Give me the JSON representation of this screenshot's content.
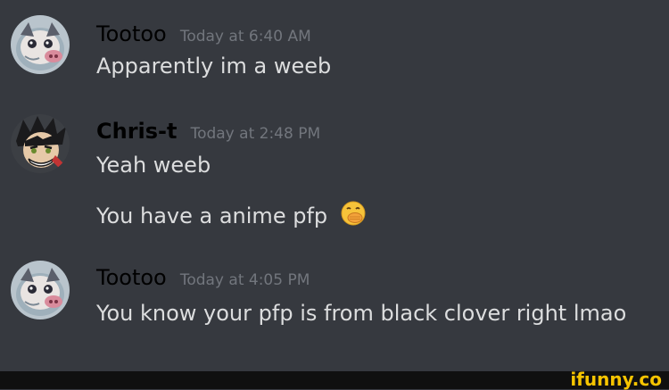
{
  "messages": [
    {
      "username": "Tootoo",
      "timestamp": "Today at 6:40 AM",
      "lines": [
        "Apparently im a weeb"
      ],
      "avatar": "boar-mask-avatar"
    },
    {
      "username": "Chris-t",
      "timestamp": "Today at 2:48 PM",
      "lines": [
        "Yeah weeb",
        "You have a anime pfp"
      ],
      "avatar": "anime-character-avatar",
      "emoji": "face-with-hand-over-mouth-emoji"
    },
    {
      "username": "Tootoo",
      "timestamp": "Today at 4:05 PM",
      "lines": [
        "You know your pfp is from black clover right lmao"
      ],
      "avatar": "boar-mask-avatar"
    }
  ],
  "watermark": "ifunny.co",
  "colors": {
    "background": "#36393f",
    "message_text": "#dcddde",
    "timestamp": "#72767d",
    "username": "#000000",
    "watermark": "#f6c400"
  }
}
